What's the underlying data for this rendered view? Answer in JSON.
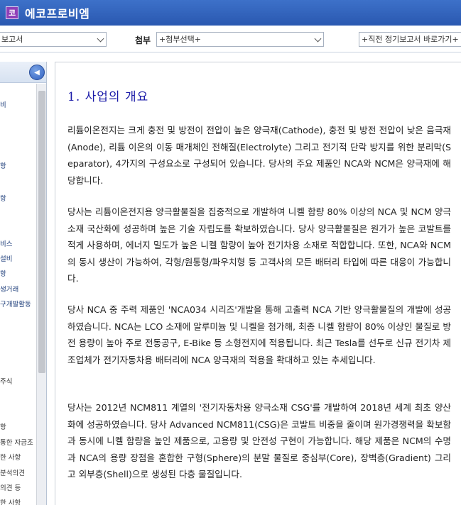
{
  "app": {
    "icon_glyph": "코",
    "title": "에코프로비엠"
  },
  "toolbar": {
    "report_select_value": "보고서",
    "attach_label": "첨부",
    "attach_select_value": "+첨부선택+",
    "goto_select_value": "+직전 정기보고서 바로가기+"
  },
  "sidebar": {
    "collapse_icon": "◀",
    "items": [
      "비",
      "항",
      "항",
      "비스",
      "설비",
      "항",
      "생거래",
      "구개발활동",
      "주식",
      "항",
      "통한 자금조",
      "한 사항",
      "분석의견",
      "의견 등",
      "한 사항"
    ]
  },
  "document": {
    "heading": "1. 사업의 개요",
    "paragraphs": [
      "리튬이온전지는 크게 충전 및 방전이 전압이 높은 양극재(Cathode), 충전 및 방전 전압이 낮은 음극재(Anode), 리튬 이온의 이동 매개체인 전해질(Electrolyte) 그리고 전기적 단락 방지를 위한 분리막(Separator), 4가지의 구성요소로 구성되어 있습니다. 당사의 주요 제품인 NCA와 NCM은 양극재에 해당합니다.",
      "당사는 리튬이온전지용 양극활물질을 집중적으로 개발하여 니켈 함량 80% 이상의 NCA 및 NCM 양극 소재 국산화에 성공하며 높은 기술 자립도를 확보하였습니다. 당사 양극활물질은 원가가 높은 코발트를 적게 사용하며, 에너지 밀도가 높은 니켈 함량이 높아 전기차용 소재로 적합합니다. 또한, NCA와 NCM의 동시 생산이 가능하여, 각형/원통형/파우치형 등 고객사의 모든 배터리 타입에 따른 대응이 가능합니다.",
      "당사 NCA 중 주력 제품인 'NCA034 시리즈'개발을 통해 고출력 NCA 기반 양극활물질의 개발에 성공하였습니다. NCA는 LCO 소재에 알루미늄 및 니켈을 첨가해, 최종 니켈 함량이 80% 이상인 물질로 방전 용량이 높아 주로 전동공구, E-Bike 등 소형전지에 적용됩니다. 최근 Tesla를 선두로 신규 전기차 제조업체가 전기자동차용 배터리에 NCA 양극재의 적용을 확대하고 있는 추세입니다.",
      "당사는 2012년 NCM811 계열의 '전기자동차용 양극소재 CSG'를 개발하여 2018년 세계 최초 양산화에 성공하였습니다. 당사 Advanced NCM811(CSG)은 코발트 비중을 줄이며 원가경쟁력을 확보함과 동시에 니켈 함량을 높인 제품으로, 고용량 및 안전성 구현이 가능합니다. 해당 제품은 NCM의 수명과 NCA의 용량 장점을 혼합한 구형(Sphere)의 분말 물질로 중심부(Core), 장벽층(Gradient) 그리고 외부층(Shell)으로 생성된 다층 물질입니다."
    ]
  }
}
